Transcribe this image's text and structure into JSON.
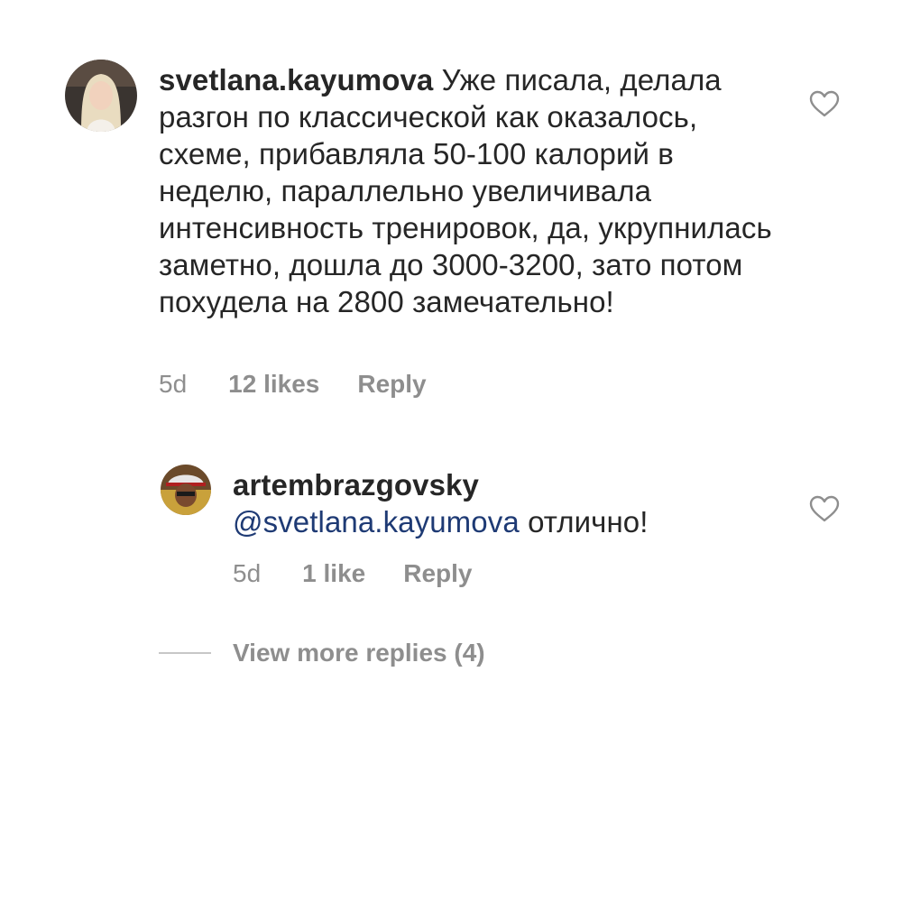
{
  "comments": [
    {
      "username": "svetlana.kayumova",
      "text": "Уже писала, делала разгон по классической как оказалось, схеме, прибавляла 50-100 калорий в неделю, параллельно увеличивала интенсивность тренировок, да, укрупнилась заметно, дошла до 3000-3200, зато потом похудела на 2800 замечательно!",
      "time": "5d",
      "likes": "12 likes",
      "reply_label": "Reply",
      "like_icon": "heart-outline-icon"
    },
    {
      "username": "artembrazgovsky",
      "mention": "@svetlana.kayumova",
      "text": "отлично!",
      "time": "5d",
      "likes": "1 like",
      "reply_label": "Reply",
      "like_icon": "heart-outline-icon"
    }
  ],
  "view_more_replies": "View more replies (4)",
  "colors": {
    "text": "#262626",
    "meta": "#8e8e8e",
    "mention": "#1e3a74"
  }
}
